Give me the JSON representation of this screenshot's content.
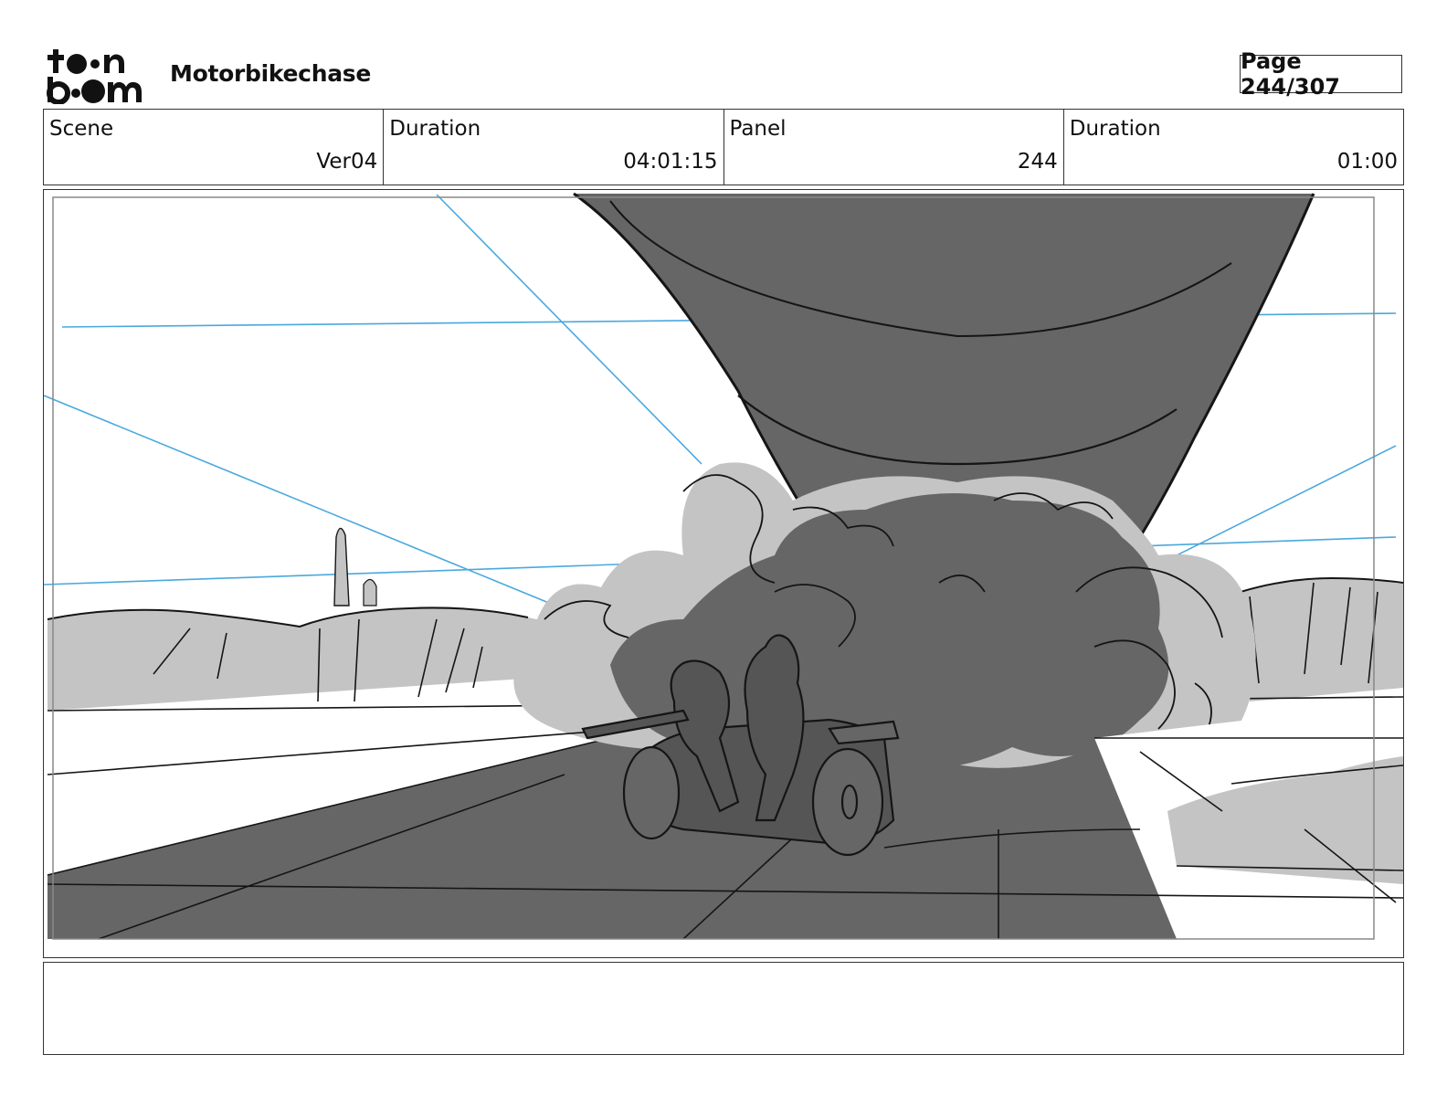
{
  "header": {
    "project_title": "Motorbikechase",
    "page_indicator": "Page 244/307",
    "logo": {
      "text": "toon boom",
      "icon": "toon-boom-logo"
    }
  },
  "info": {
    "scene_label": "Scene",
    "scene_value": "Ver04",
    "duration_label": "Duration",
    "duration_value": "04:01:15",
    "panel_label": "Panel",
    "panel_value": "244",
    "panel_duration_label": "Duration",
    "panel_duration_value": "01:00"
  },
  "colors": {
    "perspective_line": "#4aa8de",
    "dark_fill": "#666666",
    "light_fill": "#c4c4c4",
    "ink": "#151515"
  },
  "notes": ""
}
